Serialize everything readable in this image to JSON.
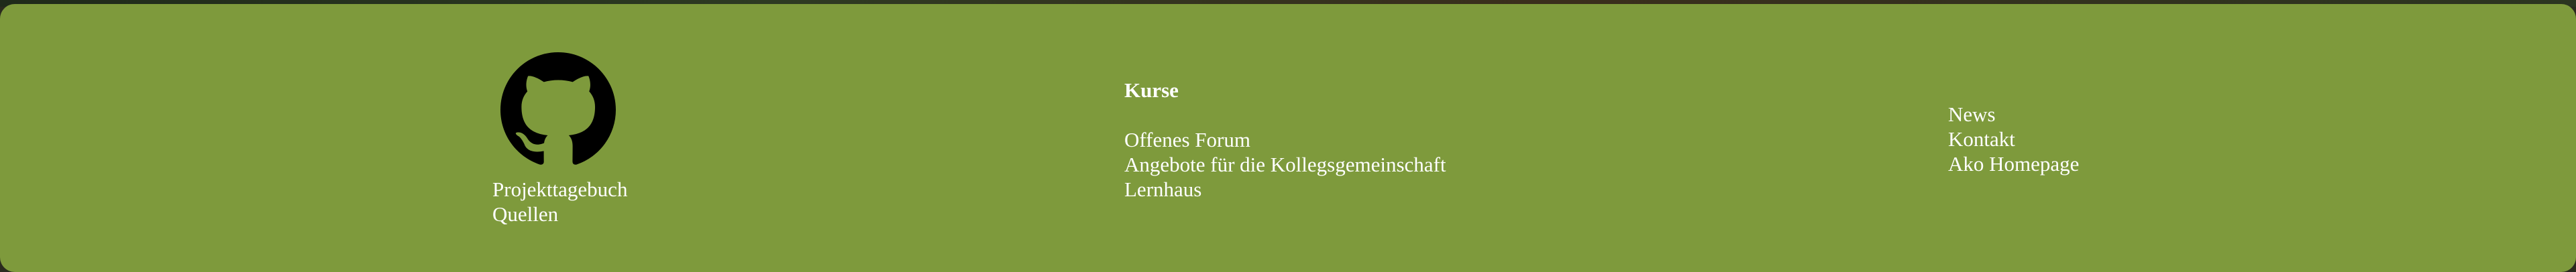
{
  "footer": {
    "left": {
      "logo_icon": "github-icon",
      "links": [
        {
          "label": "Projekttagebuch"
        },
        {
          "label": "Quellen"
        }
      ]
    },
    "middle": {
      "heading": "Kurse",
      "links": [
        {
          "label": "Offenes Forum"
        },
        {
          "label": "Angebote für die Kollegsgemeinschaft"
        },
        {
          "label": "Lernhaus"
        }
      ]
    },
    "right": {
      "links": [
        {
          "label": "News"
        },
        {
          "label": "Kontakt"
        },
        {
          "label": "Ako Homepage"
        }
      ]
    },
    "colors": {
      "background": "#7e9a3c",
      "text": "#ffffff",
      "logo": "#000000"
    }
  }
}
